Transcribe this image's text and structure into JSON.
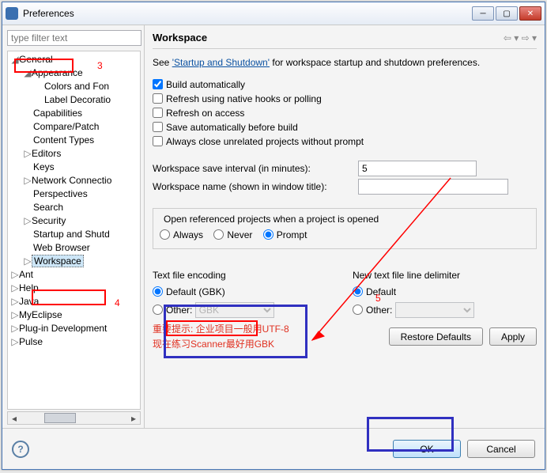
{
  "window": {
    "title": "Preferences"
  },
  "filter": {
    "placeholder": "type filter text"
  },
  "tree": {
    "general": "General",
    "appearance": "Appearance",
    "colors": "Colors and Fon",
    "labeldec": "Label Decoratio",
    "capabilities": "Capabilities",
    "compare": "Compare/Patch",
    "contenttypes": "Content Types",
    "editors": "Editors",
    "keys": "Keys",
    "network": "Network Connectio",
    "perspectives": "Perspectives",
    "search": "Search",
    "security": "Security",
    "startup": "Startup and Shutd",
    "webbrowser": "Web Browser",
    "workspace": "Workspace",
    "ant": "Ant",
    "help": "Help",
    "java": "Java",
    "myeclipse": "MyEclipse",
    "plugin": "Plug-in Development",
    "pulse": "Pulse"
  },
  "annotations": {
    "a3": "3",
    "a4": "4",
    "a5": "5"
  },
  "page": {
    "heading": "Workspace",
    "see_pre": "See ",
    "see_link": "'Startup and Shutdown'",
    "see_post": " for workspace startup and shutdown preferences.",
    "chk_build": "Build automatically",
    "chk_refresh_hooks": "Refresh using native hooks or polling",
    "chk_refresh_access": "Refresh on access",
    "chk_save_before": "Save automatically before build",
    "chk_close_unrelated": "Always close unrelated projects without prompt",
    "interval_label": "Workspace save interval (in minutes):",
    "interval_value": "5",
    "wsname_label": "Workspace name (shown in window title):",
    "wsname_value": "",
    "open_ref_title": "Open referenced projects when a project is opened",
    "always": "Always",
    "never": "Never",
    "prompt": "Prompt",
    "encoding_title": "Text file encoding",
    "default_gbk": "Default (GBK)",
    "other": "Other:",
    "other_val": "GBK",
    "delim_title": "New text file line delimiter",
    "default": "Default",
    "delim_other_val": "",
    "tip1": "重要提示: 企业项目一般用UTF-8",
    "tip2": "现在练习Scanner最好用GBK",
    "restore": "Restore Defaults",
    "apply": "Apply",
    "ok": "OK",
    "cancel": "Cancel"
  }
}
